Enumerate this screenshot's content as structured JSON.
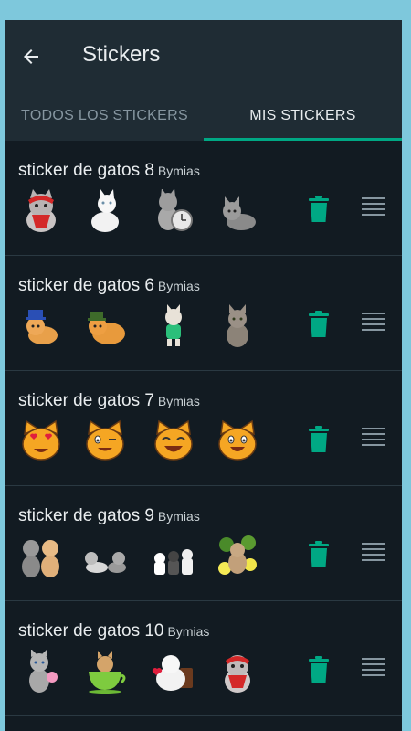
{
  "header": {
    "title": "Stickers"
  },
  "tabs": [
    {
      "label": "TODOS LOS STICKERS",
      "active": false
    },
    {
      "label": "MIS STICKERS",
      "active": true
    }
  ],
  "packs": [
    {
      "name": "sticker de gatos 8",
      "author": "Bymias",
      "stickers": [
        "cat-with-red-bandana",
        "white-fluffy-cat",
        "cat-with-alarm-clock",
        "grey-kitten"
      ]
    },
    {
      "name": "sticker de gatos 6",
      "author": "Bymias",
      "stickers": [
        "cat-with-blue-hat",
        "orange-cat-with-green-hat",
        "kitten-green-shirt",
        "tabby-kitten"
      ]
    },
    {
      "name": "sticker de gatos 7",
      "author": "Bymias",
      "stickers": [
        "heart-eyes-cat-emoji",
        "winking-cat-emoji",
        "laughing-cat-emoji",
        "smiling-cat-emoji"
      ]
    },
    {
      "name": "sticker de gatos 9",
      "author": "Bymias",
      "stickers": [
        "two-kittens",
        "lying-kittens",
        "group-of-kittens",
        "cat-with-flowers"
      ]
    },
    {
      "name": "sticker de gatos 10",
      "author": "Bymias",
      "stickers": [
        "grey-kitten-pink-bow",
        "kitten-in-teacup",
        "white-cat-with-heart",
        "cat-with-red-bandana"
      ]
    }
  ],
  "colors": {
    "accent": "#00a884",
    "background": "#121b22",
    "header": "#1f2c34"
  }
}
